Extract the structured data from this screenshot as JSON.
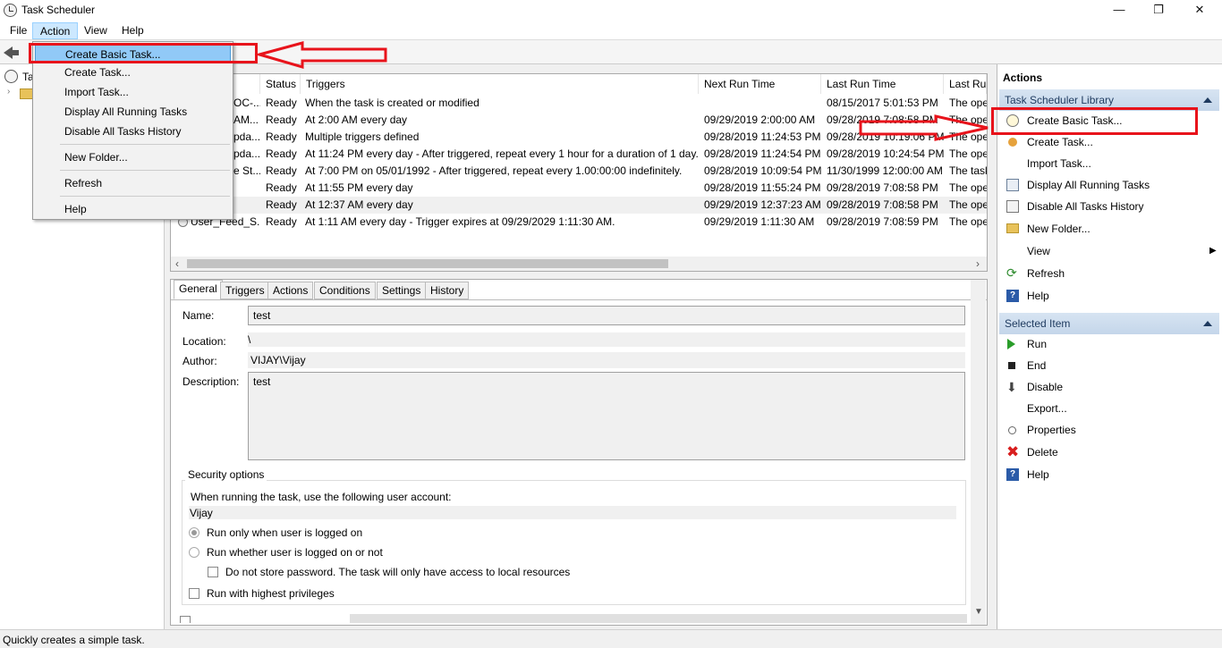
{
  "window": {
    "title": "Task Scheduler",
    "minimize": "—",
    "restore": "❐",
    "close": "✕"
  },
  "menubar": {
    "file": "File",
    "action": "Action",
    "view": "View",
    "help": "Help"
  },
  "action_menu": {
    "create_basic_task": "Create Basic Task...",
    "create_task": "Create Task...",
    "import_task": "Import Task...",
    "display_running": "Display All Running Tasks",
    "disable_history": "Disable All Tasks History",
    "new_folder": "New Folder...",
    "refresh": "Refresh",
    "help": "Help"
  },
  "tree": {
    "root_label": "Ta"
  },
  "task_list": {
    "columns": {
      "status": "Status",
      "triggers": "Triggers",
      "next_run": "Next Run Time",
      "last_run": "Last Run Time",
      "last_result": "Last Ru"
    },
    "rows": [
      {
        "name": "OC-...",
        "status": "Ready",
        "triggers": "When the task is created or modified",
        "next": "",
        "last": "08/15/2017 5:01:53 PM",
        "result": "The ope"
      },
      {
        "name": "AM...",
        "status": "Ready",
        "triggers": "At 2:00 AM every day",
        "next": "09/29/2019 2:00:00 AM",
        "last": "09/28/2019 7:08:58 PM",
        "result": "The ope"
      },
      {
        "name": "pda...",
        "status": "Ready",
        "triggers": "Multiple triggers defined",
        "next": "09/28/2019 11:24:53 PM",
        "last": "09/28/2019 10:19:06 PM",
        "result": "The ope"
      },
      {
        "name": "pda...",
        "status": "Ready",
        "triggers": "At 11:24 PM every day - After triggered, repeat every 1 hour for a duration of 1 day.",
        "next": "09/28/2019 11:24:54 PM",
        "last": "09/28/2019 10:24:54 PM",
        "result": "The ope"
      },
      {
        "name": "e St...",
        "status": "Ready",
        "triggers": "At 7:00 PM on 05/01/1992 - After triggered, repeat every 1.00:00:00 indefinitely.",
        "next": "09/28/2019 10:09:54 PM",
        "last": "11/30/1999 12:00:00 AM",
        "result": "The task"
      },
      {
        "name": "",
        "status": "Ready",
        "triggers": "At 11:55 PM every day",
        "next": "09/28/2019 11:55:24 PM",
        "last": "09/28/2019 7:08:58 PM",
        "result": "The ope"
      },
      {
        "name": "",
        "status": "Ready",
        "triggers": "At 12:37 AM every day",
        "next": "09/29/2019 12:37:23 AM",
        "last": "09/28/2019 7:08:58 PM",
        "result": "The ope"
      },
      {
        "name": "User_Feed_S...",
        "status": "Ready",
        "triggers": "At 1:11 AM every day - Trigger expires at 09/29/2029 1:11:30 AM.",
        "next": "09/29/2019 1:11:30 AM",
        "last": "09/28/2019 7:08:59 PM",
        "result": "The ope"
      }
    ]
  },
  "details": {
    "tabs": {
      "general": "General",
      "triggers": "Triggers",
      "actions": "Actions",
      "conditions": "Conditions",
      "settings": "Settings",
      "history": "History"
    },
    "name_label": "Name:",
    "name_value": "test",
    "location_label": "Location:",
    "location_value": "\\",
    "author_label": "Author:",
    "author_value": "VIJAY\\Vijay",
    "description_label": "Description:",
    "description_value": "test",
    "security_title": "Security options",
    "security_prompt": "When running the task, use the following user account:",
    "account": "Vijay",
    "run_logged_on": "Run only when user is logged on",
    "run_whether": "Run whether user is logged on or not",
    "no_store_password": "Do not store password.  The task will only have access to local resources",
    "highest_privileges": "Run with highest privileges"
  },
  "actions_panel": {
    "header": "Actions",
    "library_section": "Task Scheduler Library",
    "library_items": {
      "create_basic_task": "Create Basic Task...",
      "create_task": "Create Task...",
      "import_task": "Import Task...",
      "display_running": "Display All Running Tasks",
      "disable_history": "Disable All Tasks History",
      "new_folder": "New Folder...",
      "view": "View",
      "refresh": "Refresh",
      "help": "Help"
    },
    "selected_section": "Selected Item",
    "selected_items": {
      "run": "Run",
      "end": "End",
      "disable": "Disable",
      "export": "Export...",
      "properties": "Properties",
      "delete": "Delete",
      "help": "Help"
    }
  },
  "status_bar": {
    "text": "Quickly creates a simple task."
  },
  "colors": {
    "highlight_red": "#e8131b",
    "menu_highlight": "#91c9f7",
    "section_blue": "#c4d6ea"
  }
}
